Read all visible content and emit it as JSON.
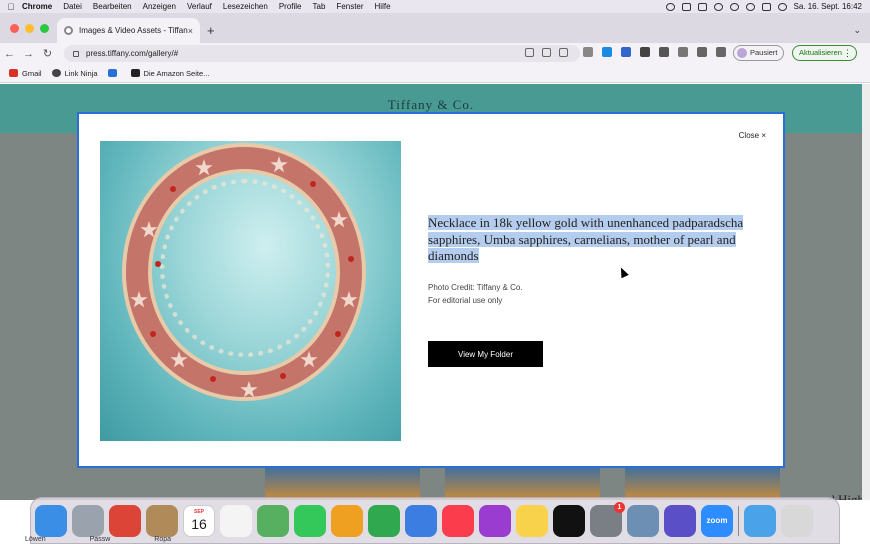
{
  "menubar": {
    "items": [
      "Chrome",
      "Datei",
      "Bearbeiten",
      "Anzeigen",
      "Verlauf",
      "Lesezeichen",
      "Profile",
      "Tab",
      "Fenster",
      "Hilfe"
    ],
    "clock": "Sa. 16. Sept. 16:42"
  },
  "browser": {
    "tab_title": "Images & Video Assets - Tiffan",
    "url": "press.tiffany.com/gallery/#",
    "paused_label": "Pausiert",
    "update_label": "Aktualisieren"
  },
  "bookmarks": [
    {
      "label": "Gmail",
      "icon": "gmail-icon",
      "color": "#d93025"
    },
    {
      "label": "Link Ninja",
      "icon": "link-ninja-icon",
      "color": "#444444"
    },
    {
      "label": "",
      "icon": "extension-icon",
      "color": "#2a6fd6"
    },
    {
      "label": "Die Amazon Seite...",
      "icon": "amazon-icon",
      "color": "#222222"
    }
  ],
  "page": {
    "brand": "Tiffany & Co.",
    "peek_text": "d High"
  },
  "modal": {
    "close_label": "Close ×",
    "description": "Necklace in 18k yellow gold with unenhanced padparadscha sapphires, Umba sapphires, carnelians, mother of pearl and diamonds",
    "credit_line1": "Photo Credit: Tiffany & Co.",
    "credit_line2": "For editorial use only",
    "folder_button": "View My Folder"
  },
  "dock": {
    "apps": [
      {
        "name": "Finder",
        "icon": "finder-icon",
        "color": "#3a8ee6"
      },
      {
        "name": "Launchpad",
        "icon": "launchpad-icon",
        "color": "#9aa3ad"
      },
      {
        "name": "Chrome",
        "icon": "chrome-icon",
        "color": "#db4437"
      },
      {
        "name": "Contacts",
        "icon": "contacts-icon",
        "color": "#b08a58"
      },
      {
        "name": "Calendar",
        "icon": "calendar-icon",
        "color": "#ffffff",
        "month": "SEP",
        "day": "16"
      },
      {
        "name": "Reminders",
        "icon": "reminders-icon",
        "color": "#f4f4f4"
      },
      {
        "name": "Maps",
        "icon": "maps-icon",
        "color": "#56b05f"
      },
      {
        "name": "FaceTime",
        "icon": "facetime-icon",
        "color": "#34c759"
      },
      {
        "name": "Pages",
        "icon": "pages-icon",
        "color": "#f0a020"
      },
      {
        "name": "Numbers",
        "icon": "numbers-icon",
        "color": "#2fa84f"
      },
      {
        "name": "Keynote",
        "icon": "keynote-icon",
        "color": "#3b7de0"
      },
      {
        "name": "Music",
        "icon": "music-icon",
        "color": "#fa3c4c"
      },
      {
        "name": "Podcasts",
        "icon": "podcasts-icon",
        "color": "#9a3ccf"
      },
      {
        "name": "Notes",
        "icon": "notes-icon",
        "color": "#f8d24a"
      },
      {
        "name": "TV",
        "icon": "tv-icon",
        "color": "#111111"
      },
      {
        "name": "System Settings",
        "icon": "settings-icon",
        "color": "#7a7f86",
        "badge": "1"
      },
      {
        "name": "Preview",
        "icon": "preview-icon",
        "color": "#6d8fb3"
      },
      {
        "name": "iMovie",
        "icon": "imovie-icon",
        "color": "#5b4fc7"
      },
      {
        "name": "Zoom",
        "icon": "zoom-icon",
        "color": "#2d8cff",
        "text": "zoom"
      },
      {
        "name": "Downloads",
        "icon": "downloads-icon",
        "color": "#4aa3e8"
      },
      {
        "name": "Trash",
        "icon": "trash-icon",
        "color": "#d8d8d8"
      }
    ],
    "labels": [
      "Löwen",
      "Passw",
      "Ropa"
    ]
  },
  "colors": {
    "teal_header": "#4a9a94",
    "modal_border": "#2a6fd6",
    "selection": "#b4cdee"
  }
}
